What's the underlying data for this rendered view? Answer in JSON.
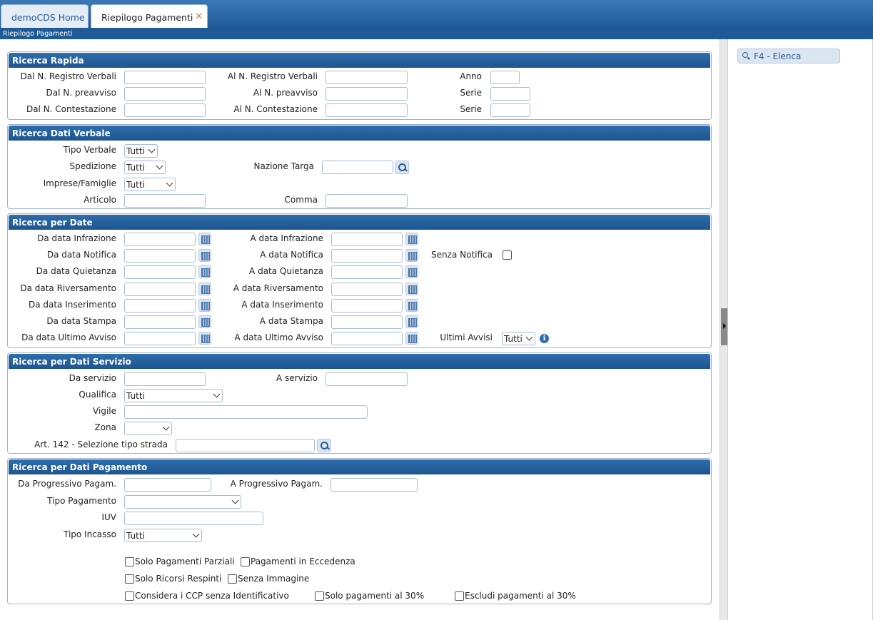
{
  "tabs": {
    "home": "demoCDS Home",
    "active": "Riepilogo Pagamenti",
    "close": "✕"
  },
  "breadcrumb": "Riepilogo Pagamenti",
  "right_panel": {
    "f4_button": "F4 - Elenca"
  },
  "ricerca_rapida": {
    "title": "Ricerca Rapida",
    "dal_registro": "Dal N. Registro Verbali",
    "al_registro": "Al N. Registro Verbali",
    "anno": "Anno",
    "dal_preavviso": "Dal N. preavviso",
    "al_preavviso": "Al N. preavviso",
    "serie1": "Serie",
    "dal_contestazione": "Dal N. Contestazione",
    "al_contestazione": "Al N. Contestazione",
    "serie2": "Serie"
  },
  "ricerca_dati_verbale": {
    "title": "Ricerca Dati Verbale",
    "tipo_verbale": "Tipo Verbale",
    "tipo_verbale_value": "Tutti",
    "spedizione": "Spedizione",
    "spedizione_value": "Tutti",
    "nazione_targa": "Nazione Targa",
    "imprese": "Imprese/Famiglie",
    "imprese_value": "Tutti",
    "articolo": "Articolo",
    "comma": "Comma"
  },
  "ricerca_date": {
    "title": "Ricerca per Date",
    "rows": [
      {
        "da": "Da data Infrazione",
        "a": "A data Infrazione"
      },
      {
        "da": "Da data Notifica",
        "a": "A data Notifica"
      },
      {
        "da": "Da data Quietanza",
        "a": "A data Quietanza"
      },
      {
        "da": "Da data Riversamento",
        "a": "A data Riversamento"
      },
      {
        "da": "Da data Inserimento",
        "a": "A data Inserimento"
      },
      {
        "da": "Da data Stampa",
        "a": "A data Stampa"
      },
      {
        "da": "Da data Ultimo Avviso",
        "a": "A data Ultimo Avviso"
      }
    ],
    "senza_notifica": "Senza Notifica",
    "ultimi_avvisi": "Ultimi Avvisi",
    "ultimi_avvisi_value": "Tutti",
    "info": "i"
  },
  "ricerca_servizio": {
    "title": "Ricerca per Dati Servizio",
    "da_servizio": "Da servizio",
    "a_servizio": "A servizio",
    "qualifica": "Qualifica",
    "qualifica_value": "Tutti",
    "vigile": "Vigile",
    "zona": "Zona",
    "art142": "Art. 142 - Selezione tipo strada"
  },
  "ricerca_pagamento": {
    "title": "Ricerca per Dati Pagamento",
    "da_progressivo": "Da Progressivo Pagam.",
    "a_progressivo": "A Progressivo Pagam.",
    "tipo_pagamento": "Tipo Pagamento",
    "iuv": "IUV",
    "tipo_incasso": "Tipo Incasso",
    "tipo_incasso_value": "Tutti",
    "checkboxes": {
      "solo_parziali": "Solo Pagamenti Parziali",
      "eccedenza": "Pagamenti in Eccedenza",
      "ricorsi_respinti": "Solo Ricorsi Respinti",
      "senza_immagine": "Senza Immagine",
      "ccp_senza_id": "Considera i CCP senza Identificativo",
      "solo_30": "Solo pagamenti al 30%",
      "escludi_30": "Escludi pagamenti al 30%"
    }
  }
}
